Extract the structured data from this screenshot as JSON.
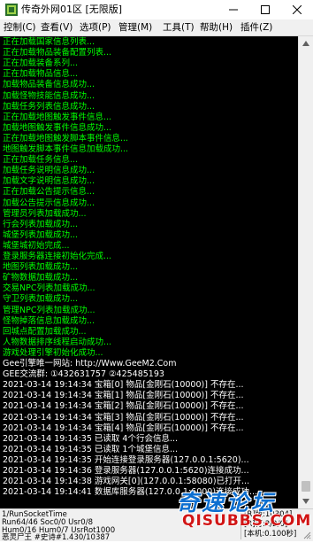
{
  "window": {
    "title": "传奇外网01区 [无限版]",
    "minimize_icon": "minimize-icon",
    "maximize_icon": "maximize-icon",
    "close_icon": "close-icon"
  },
  "menu": {
    "items": [
      {
        "label": "控制(C)"
      },
      {
        "label": "查看(V)"
      },
      {
        "label": "选项(P)"
      },
      {
        "label": "管理(M)"
      },
      {
        "label": "工具(T)"
      },
      {
        "label": "帮助(H)"
      },
      {
        "label": "插件(Z)"
      }
    ]
  },
  "colors": {
    "console_bg": "#000000",
    "log_green": "#00ff00",
    "log_white": "#ffffff",
    "log_yellow": "#ffff00",
    "log_red": "#ff3030",
    "log_cyan": "#00ffff",
    "watermark_blue": "#0d6fd0",
    "watermark_red": "#d11515"
  },
  "log": {
    "lines": [
      {
        "text": "正在加载国家信息列表...",
        "color": "#00ff00"
      },
      {
        "text": "正在加载物品装备配置列表...",
        "color": "#00ff00"
      },
      {
        "text": "正在加载装备系列...",
        "color": "#00ff00"
      },
      {
        "text": "正在加载物品信息...",
        "color": "#00ff00"
      },
      {
        "text": "加载物品装备信息成功...",
        "color": "#00ff00"
      },
      {
        "text": "加载怪物技能信息成功...",
        "color": "#00ff00"
      },
      {
        "text": "加载任务列表信息成功...",
        "color": "#00ff00"
      },
      {
        "text": "正在加载地图触发事件信息...",
        "color": "#00ff00"
      },
      {
        "text": "加载地图触发事件信息成功...",
        "color": "#00ff00"
      },
      {
        "text": "正在加载地图触发脚本事件信息...",
        "color": "#00ff00"
      },
      {
        "text": "地图触发脚本事件信息加载成功...",
        "color": "#00ff00"
      },
      {
        "text": "正在加载任务信息...",
        "color": "#00ff00"
      },
      {
        "text": "加载任务说明信息成功...",
        "color": "#00ff00"
      },
      {
        "text": "加载文字说明信息成功...",
        "color": "#00ff00"
      },
      {
        "text": "正在加载公告提示信息...",
        "color": "#00ff00"
      },
      {
        "text": "加载公告提示信息成功...",
        "color": "#00ff00"
      },
      {
        "text": "管理员列表加载成功...",
        "color": "#00ff00"
      },
      {
        "text": "行会列表加载成功...",
        "color": "#00ff00"
      },
      {
        "text": "城堡列表加载成功...",
        "color": "#00ff00"
      },
      {
        "text": "城堡城初始完成...",
        "color": "#00ff00"
      },
      {
        "text": "登录服务器连接初始化完成...",
        "color": "#00ff00"
      },
      {
        "text": "地图列表加载成功...",
        "color": "#00ff00"
      },
      {
        "text": "矿物数据加载成功...",
        "color": "#00ff00"
      },
      {
        "text": "交易NPC列表加载成功...",
        "color": "#00ff00"
      },
      {
        "text": "守卫列表加载成功...",
        "color": "#00ff00"
      },
      {
        "text": "管理NPC列表加载成功...",
        "color": "#00ff00"
      },
      {
        "text": "怪物掉落信息加载成功...",
        "color": "#00ff00"
      },
      {
        "text": "回城点配置加载成功...",
        "color": "#00ff00"
      },
      {
        "text": "人物数据排序线程启动成功...",
        "color": "#00ff00"
      },
      {
        "text": "游戏处理引擎初始化成功...",
        "color": "#00ff00"
      },
      {
        "text": "Gee引擎唯一网站: http://Www.GeeM2.Com",
        "color": "#ffffff"
      },
      {
        "text": "GEE交流群: ①432631757    ②425485193",
        "color": "#ffffff"
      },
      {
        "text": "2021-03-14 19:14:34 宝箱[0] 物品[金刚石(10000)] 不存在...",
        "color": "#ffffff"
      },
      {
        "text": "2021-03-14 19:14:34 宝箱[1] 物品[金刚石(10000)] 不存在...",
        "color": "#ffffff"
      },
      {
        "text": "2021-03-14 19:14:34 宝箱[2] 物品[金刚石(10000)] 不存在...",
        "color": "#ffffff"
      },
      {
        "text": "2021-03-14 19:14:34 宝箱[3] 物品[金刚石(10000)] 不存在...",
        "color": "#ffffff"
      },
      {
        "text": "2021-03-14 19:14:34 宝箱[4] 物品[金刚石(10000)] 不存在...",
        "color": "#ffffff"
      },
      {
        "text": "2021-03-14 19:14:35 已读取 4个行会信息...",
        "color": "#ffffff"
      },
      {
        "text": "2021-03-14 19:14:35 已读取 1个城堡信息...",
        "color": "#ffffff"
      },
      {
        "text": "2021-03-14 19:14:35 开始连接登录服务器(127.0.0.1:5620)...",
        "color": "#ffffff"
      },
      {
        "text": "2021-03-14 19:14:36 登录服务器(127.0.0.1:5620)连接成功...",
        "color": "#ffffff"
      },
      {
        "text": "2021-03-14 19:14:38 游戏网关[0](127.0.0.1:58080)已打开...",
        "color": "#ffffff"
      },
      {
        "text": "2021-03-14 19:14:41 数据库服务器(127.0.0.1:6000)连接成功...",
        "color": "#ffffff"
      }
    ]
  },
  "status": {
    "left": [
      "1/RunSocketTime",
      "Run64/46 Soc0/0 Usr0/8",
      "Hum0/16 Hum0/7 UsrRot1000",
      "恶灵尸王 #史诗#1.430/10387"
    ],
    "right": [
      "[R]版:10304]",
      "[R]行:2/2/0]",
      "[本机:0.100秒]"
    ]
  },
  "watermark": {
    "top": "奇速论坛",
    "bottom": "QISUBBS.COM"
  },
  "scrollbar": {
    "up_icon": "arrow-up-icon",
    "down_icon": "arrow-down-icon"
  }
}
